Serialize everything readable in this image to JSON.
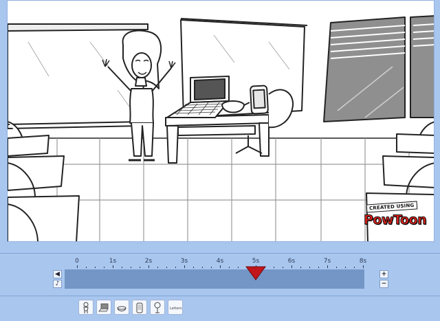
{
  "watermark": {
    "created_text": "CREATED USING",
    "brand_text": "PowToon"
  },
  "timeline": {
    "tick_labels": [
      "0",
      "1s",
      "2s",
      "3s",
      "4s",
      "5s",
      "6s",
      "7s",
      "8s"
    ],
    "playhead_seconds": 5,
    "add_label": "+",
    "remove_label": "−"
  },
  "assets": [
    {
      "icon": "character-icon"
    },
    {
      "icon": "laptop-icon"
    },
    {
      "icon": "bowl-icon"
    },
    {
      "icon": "phone-icon"
    },
    {
      "icon": "lamp-icon"
    },
    {
      "icon": "text-icon",
      "label": "Letters"
    }
  ],
  "colors": {
    "background": "#a9c6ee",
    "track": "#7396c6",
    "playhead": "#c0161c"
  }
}
